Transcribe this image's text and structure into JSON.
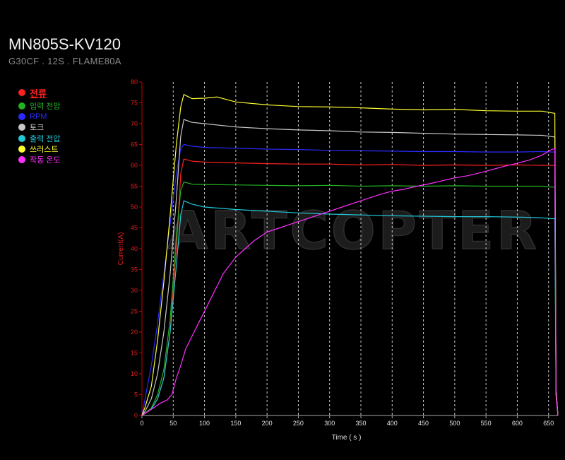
{
  "header": {
    "title": "MN805S-KV120",
    "subtitle": "G30CF . 12S . FLAME80A"
  },
  "watermark": "ARTCOPTER",
  "chart_data": {
    "type": "line",
    "xlabel": "Time ( s )",
    "ylabel": "Current(A)",
    "xlim": [
      0,
      665
    ],
    "ylim": [
      0,
      80
    ],
    "x_ticks": [
      0,
      50,
      100,
      150,
      200,
      250,
      300,
      350,
      400,
      450,
      500,
      550,
      600,
      650
    ],
    "y_ticks": [
      0,
      5,
      10,
      15,
      20,
      25,
      30,
      35,
      40,
      45,
      50,
      55,
      60,
      65,
      70,
      75,
      80
    ],
    "grid": "vertical-dashed",
    "legend_position": "left",
    "series": [
      {
        "name": "전류",
        "color": "#ff2020",
        "points": [
          [
            0,
            0
          ],
          [
            5,
            0.5
          ],
          [
            15,
            1.5
          ],
          [
            25,
            4
          ],
          [
            35,
            9
          ],
          [
            45,
            20
          ],
          [
            55,
            40
          ],
          [
            62,
            58
          ],
          [
            67,
            61.5
          ],
          [
            80,
            61
          ],
          [
            100,
            60.8
          ],
          [
            150,
            60.6
          ],
          [
            200,
            60.4
          ],
          [
            250,
            60.3
          ],
          [
            300,
            60.3
          ],
          [
            350,
            60.1
          ],
          [
            400,
            60.2
          ],
          [
            450,
            60
          ],
          [
            500,
            60.1
          ],
          [
            550,
            60
          ],
          [
            600,
            60.1
          ],
          [
            640,
            60
          ],
          [
            655,
            60
          ],
          [
            660,
            60
          ],
          [
            662,
            5
          ],
          [
            665,
            0
          ]
        ]
      },
      {
        "name": "입력 전압",
        "color": "#22b222",
        "points": [
          [
            0,
            0
          ],
          [
            5,
            0.5
          ],
          [
            15,
            1.8
          ],
          [
            25,
            5
          ],
          [
            35,
            11
          ],
          [
            45,
            23
          ],
          [
            55,
            43
          ],
          [
            62,
            54
          ],
          [
            67,
            56
          ],
          [
            80,
            55.5
          ],
          [
            100,
            55.4
          ],
          [
            150,
            55.3
          ],
          [
            200,
            55.2
          ],
          [
            250,
            55.1
          ],
          [
            300,
            55.2
          ],
          [
            350,
            55
          ],
          [
            400,
            55.1
          ],
          [
            450,
            55
          ],
          [
            500,
            55.1
          ],
          [
            550,
            55
          ],
          [
            600,
            55
          ],
          [
            640,
            55
          ],
          [
            655,
            54.8
          ],
          [
            660,
            54.8
          ],
          [
            662,
            6
          ],
          [
            665,
            0
          ]
        ]
      },
      {
        "name": "RPM",
        "color": "#2a2aff",
        "points": [
          [
            0,
            0
          ],
          [
            5,
            4
          ],
          [
            15,
            12
          ],
          [
            25,
            22
          ],
          [
            35,
            34
          ],
          [
            45,
            46
          ],
          [
            55,
            58
          ],
          [
            62,
            64
          ],
          [
            67,
            65
          ],
          [
            80,
            64.6
          ],
          [
            100,
            64.3
          ],
          [
            150,
            64.1
          ],
          [
            200,
            63.9
          ],
          [
            250,
            63.8
          ],
          [
            300,
            63.6
          ],
          [
            350,
            63.5
          ],
          [
            400,
            63.4
          ],
          [
            450,
            63.3
          ],
          [
            500,
            63.3
          ],
          [
            550,
            63.2
          ],
          [
            600,
            63.2
          ],
          [
            640,
            63.3
          ],
          [
            655,
            63.2
          ],
          [
            660,
            63.2
          ],
          [
            662,
            6
          ],
          [
            665,
            0
          ]
        ]
      },
      {
        "name": "토크",
        "color": "#c8c8c8",
        "points": [
          [
            0,
            0
          ],
          [
            5,
            1
          ],
          [
            15,
            4
          ],
          [
            25,
            10
          ],
          [
            35,
            20
          ],
          [
            45,
            34
          ],
          [
            55,
            52
          ],
          [
            62,
            67
          ],
          [
            67,
            71
          ],
          [
            80,
            70.3
          ],
          [
            100,
            70
          ],
          [
            150,
            69.2
          ],
          [
            200,
            68.8
          ],
          [
            250,
            68.5
          ],
          [
            300,
            68.3
          ],
          [
            350,
            68
          ],
          [
            400,
            67.9
          ],
          [
            450,
            67.7
          ],
          [
            500,
            67.5
          ],
          [
            550,
            67.4
          ],
          [
            600,
            67.3
          ],
          [
            640,
            67.2
          ],
          [
            655,
            66.9
          ],
          [
            660,
            66.8
          ],
          [
            662,
            6
          ],
          [
            665,
            0
          ]
        ]
      },
      {
        "name": "출력 전압",
        "color": "#20c8d8",
        "points": [
          [
            0,
            0
          ],
          [
            5,
            0.5
          ],
          [
            15,
            1.5
          ],
          [
            25,
            4
          ],
          [
            35,
            9
          ],
          [
            45,
            20
          ],
          [
            55,
            36
          ],
          [
            62,
            48
          ],
          [
            67,
            51.5
          ],
          [
            80,
            50.7
          ],
          [
            100,
            50
          ],
          [
            150,
            49.4
          ],
          [
            200,
            49
          ],
          [
            250,
            48.6
          ],
          [
            300,
            48.3
          ],
          [
            350,
            48.1
          ],
          [
            400,
            47.9
          ],
          [
            450,
            47.8
          ],
          [
            500,
            47.7
          ],
          [
            550,
            47.7
          ],
          [
            600,
            47.6
          ],
          [
            640,
            47.4
          ],
          [
            655,
            47.2
          ],
          [
            660,
            47.2
          ],
          [
            662,
            5
          ],
          [
            665,
            0
          ]
        ]
      },
      {
        "name": "쓰러스트",
        "color": "#ffff30",
        "points": [
          [
            0,
            0
          ],
          [
            5,
            2
          ],
          [
            15,
            7
          ],
          [
            25,
            18
          ],
          [
            35,
            32
          ],
          [
            45,
            48
          ],
          [
            55,
            65
          ],
          [
            62,
            74
          ],
          [
            67,
            77
          ],
          [
            80,
            76
          ],
          [
            100,
            76.1
          ],
          [
            120,
            76.4
          ],
          [
            150,
            75.2
          ],
          [
            200,
            74.5
          ],
          [
            250,
            74.1
          ],
          [
            300,
            74
          ],
          [
            350,
            73.8
          ],
          [
            400,
            73.5
          ],
          [
            450,
            73.3
          ],
          [
            500,
            73.4
          ],
          [
            550,
            73.1
          ],
          [
            600,
            73
          ],
          [
            640,
            73
          ],
          [
            655,
            72.6
          ],
          [
            660,
            72.5
          ],
          [
            662,
            6
          ],
          [
            665,
            0
          ]
        ]
      },
      {
        "name": "작동 온도",
        "color": "#ff30ff",
        "points": [
          [
            0,
            0
          ],
          [
            10,
            1
          ],
          [
            20,
            2
          ],
          [
            30,
            3
          ],
          [
            40,
            3.7
          ],
          [
            48,
            5
          ],
          [
            55,
            9
          ],
          [
            62,
            12
          ],
          [
            70,
            16
          ],
          [
            80,
            19
          ],
          [
            90,
            22
          ],
          [
            100,
            25
          ],
          [
            110,
            28
          ],
          [
            120,
            31
          ],
          [
            130,
            34
          ],
          [
            140,
            36
          ],
          [
            150,
            38
          ],
          [
            165,
            40
          ],
          [
            180,
            42
          ],
          [
            200,
            44
          ],
          [
            220,
            45
          ],
          [
            240,
            46
          ],
          [
            260,
            47
          ],
          [
            280,
            48
          ],
          [
            300,
            49
          ],
          [
            320,
            50
          ],
          [
            340,
            51
          ],
          [
            360,
            52
          ],
          [
            380,
            53
          ],
          [
            400,
            53.8
          ],
          [
            420,
            54.3
          ],
          [
            440,
            55
          ],
          [
            460,
            55.6
          ],
          [
            480,
            56.3
          ],
          [
            500,
            57
          ],
          [
            520,
            57.5
          ],
          [
            540,
            58.2
          ],
          [
            560,
            59
          ],
          [
            580,
            59.8
          ],
          [
            600,
            60.5
          ],
          [
            620,
            61.3
          ],
          [
            640,
            62.5
          ],
          [
            655,
            63.8
          ],
          [
            660,
            64
          ],
          [
            662,
            5
          ],
          [
            665,
            0
          ]
        ]
      }
    ]
  }
}
